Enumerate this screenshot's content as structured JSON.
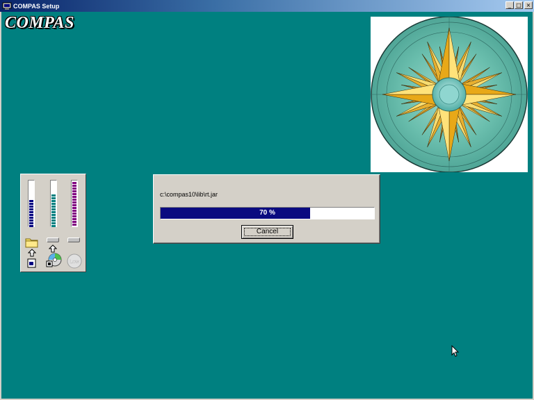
{
  "window": {
    "title": "COMPAS Setup",
    "icon": "setup-icon",
    "controls": {
      "minimize": "_",
      "maximize": "□",
      "close": "×"
    }
  },
  "logo": {
    "text": "COMPAS"
  },
  "meters": {
    "items": [
      {
        "name": "disk-space-meter",
        "color": "#000080",
        "icon": "folder-icon"
      },
      {
        "name": "cd-read-meter",
        "color": "#008080",
        "icon": "cd-icon"
      },
      {
        "name": "memory-meter",
        "color": "#800080",
        "icon": "low-icon",
        "badge": "Low"
      }
    ]
  },
  "dialog": {
    "file_path": "c:\\compas10\\lib\\rt.jar",
    "progress_percent": 70,
    "progress_label": "70 %",
    "cancel_label": "Cancel"
  },
  "colors": {
    "desktop": "#008080",
    "progress_fill": "#0a0a80",
    "dialog": "#d4d0c8"
  }
}
